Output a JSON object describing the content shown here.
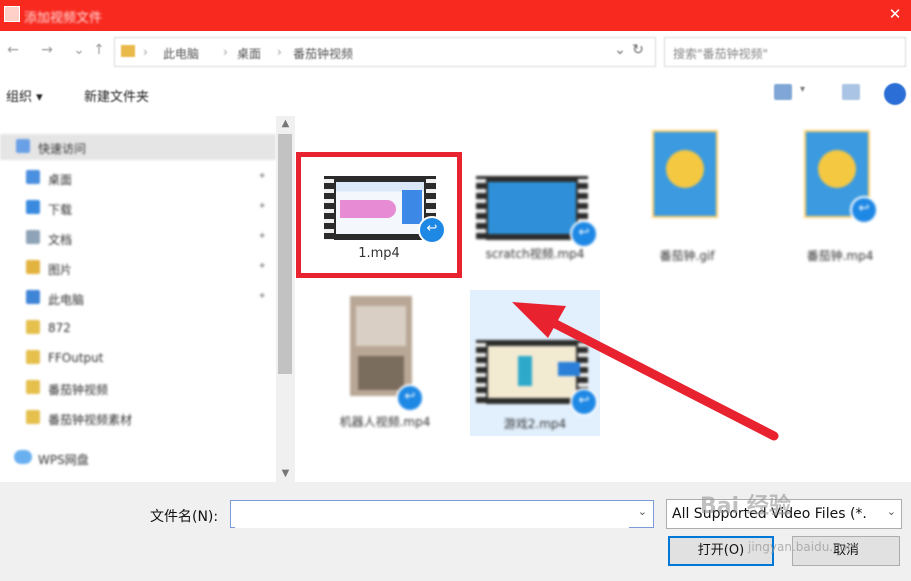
{
  "window": {
    "title": "添加视频文件",
    "close_glyph": "✕"
  },
  "address": {
    "back_icon": "back-arrow-icon",
    "forward_icon": "forward-arrow-icon",
    "up_icon": "up-arrow-icon",
    "crumbs": [
      "此电脑",
      "桌面",
      "番茄钟视频"
    ],
    "search_placeholder": "搜索\"番茄钟视频\""
  },
  "toolbar": {
    "organize": "组织 ▾",
    "new_folder": "新建文件夹"
  },
  "sidebar": {
    "items": [
      {
        "label": "快速访问",
        "color": "#6aa0e6",
        "pin": ""
      },
      {
        "label": "桌面",
        "color": "#4b8fe0",
        "pin": "✦"
      },
      {
        "label": "下载",
        "color": "#3a8be0",
        "pin": "✦"
      },
      {
        "label": "文档",
        "color": "#8fa3b8",
        "pin": "✦"
      },
      {
        "label": "图片",
        "color": "#e3b33f",
        "pin": "✦"
      },
      {
        "label": "此电脑",
        "color": "#3f85d6",
        "pin": "✦"
      },
      {
        "label": "872",
        "color": "#e6c04d",
        "pin": ""
      },
      {
        "label": "FFOutput",
        "color": "#e6c04d",
        "pin": ""
      },
      {
        "label": "番茄钟视频",
        "color": "#e6c04d",
        "pin": ""
      },
      {
        "label": "番茄钟视频素材",
        "color": "#e6c04d",
        "pin": ""
      },
      {
        "label": "WPS网盘",
        "color": "#6ab0f0",
        "pin": ""
      }
    ]
  },
  "files": [
    {
      "name": "1.mp4",
      "type": "video"
    },
    {
      "name": "scratch视频.mp4",
      "type": "video"
    },
    {
      "name": "番茄钟.gif",
      "type": "image"
    },
    {
      "name": "番茄钟.mp4",
      "type": "video"
    },
    {
      "name": "机器人视频.mp4",
      "type": "video"
    },
    {
      "name": "游戏2.mp4",
      "type": "video"
    }
  ],
  "footer": {
    "filename_label": "文件名(N):",
    "filename_value": "",
    "filter_value": "All Supported Video Files (*.",
    "open_label": "打开(O)",
    "cancel_label": "取消"
  },
  "watermark": {
    "brand": "Bai 经验",
    "url": "jingyan.baidu.com"
  },
  "colors": {
    "titlebar": "#f8291f",
    "highlight": "#e8232f",
    "arrow": "#e8232f",
    "selection": "#cfe6fb"
  }
}
